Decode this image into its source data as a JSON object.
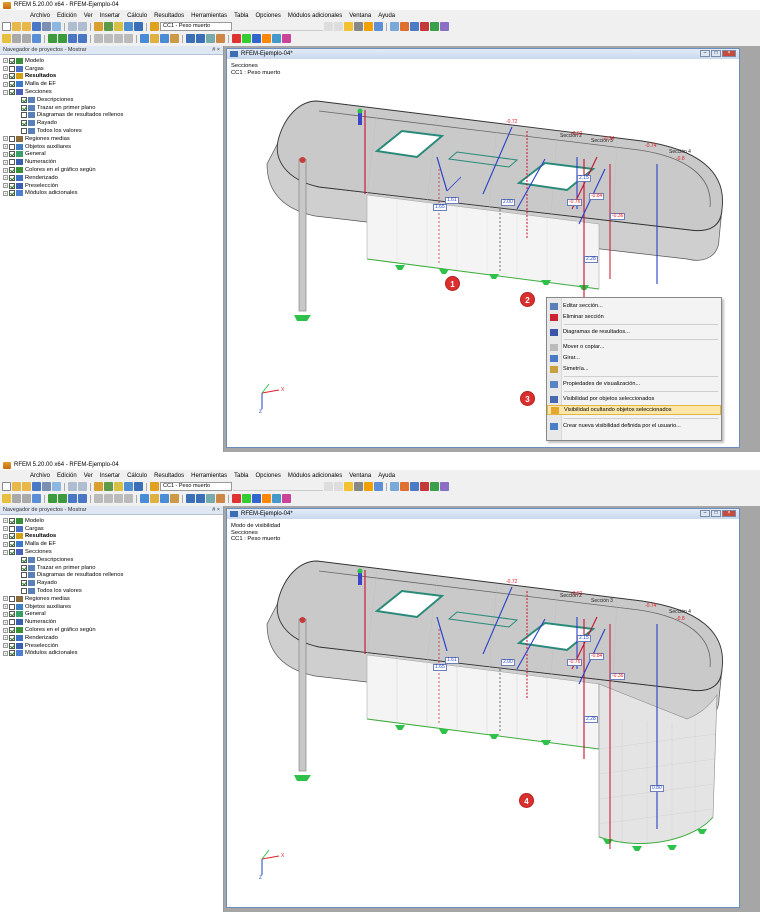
{
  "top": {
    "app_title": "RFEM 5.20.00 x64 - RFEM-Ejemplo-04",
    "menu": [
      "Archivo",
      "Edición",
      "Ver",
      "Insertar",
      "Cálculo",
      "Resultados",
      "Herramientas",
      "Tabla",
      "Opciones",
      "Módulos adicionales",
      "Ventana",
      "Ayuda"
    ],
    "load_case": "CC1 - Peso muerto",
    "navigator_title": "Navegador de proyectos - Mostrar",
    "navigator_pin": "# ×",
    "tree": [
      {
        "label": "Modelo",
        "level": 0,
        "exp": "+",
        "check": true
      },
      {
        "label": "Cargas",
        "level": 0,
        "exp": "+",
        "check": false
      },
      {
        "label": "Resultados",
        "level": 0,
        "exp": "+",
        "check": true
      },
      {
        "label": "Malla de EF",
        "level": 0,
        "exp": "+",
        "check": true
      },
      {
        "label": "Secciones",
        "level": 0,
        "exp": "−",
        "check": true
      },
      {
        "label": "Descripciones",
        "level": 1,
        "exp": "",
        "check": true
      },
      {
        "label": "Trazar en primer plano",
        "level": 1,
        "exp": "",
        "check": true
      },
      {
        "label": "Diagramas de resultados rellenos",
        "level": 1,
        "exp": "",
        "check": false
      },
      {
        "label": "Rayado",
        "level": 1,
        "exp": "",
        "check": true
      },
      {
        "label": "Todos los valores",
        "level": 1,
        "exp": "",
        "check": false
      },
      {
        "label": "Regiones medias",
        "level": 0,
        "exp": "+",
        "check": false
      },
      {
        "label": "Objetos auxiliares",
        "level": 0,
        "exp": "+",
        "check": false
      },
      {
        "label": "General",
        "level": 0,
        "exp": "+",
        "check": true
      },
      {
        "label": "Numeración",
        "level": 0,
        "exp": "+",
        "check": false
      },
      {
        "label": "Colores en el gráfico según",
        "level": 0,
        "exp": "+",
        "check": true
      },
      {
        "label": "Renderizado",
        "level": 0,
        "exp": "+",
        "check": true
      },
      {
        "label": "Preselección",
        "level": 0,
        "exp": "+",
        "check": true
      },
      {
        "label": "Módulos adicionales",
        "level": 0,
        "exp": "+",
        "check": true
      }
    ],
    "window_title": "RFEM-Ejemplo-04*",
    "info_lines": [
      "Secciones",
      "CC1 : Peso muerto"
    ],
    "section_labels": [
      "Sección 1",
      "Sección 2",
      "Sección 3",
      "Sección 4"
    ],
    "values_red": [
      "-0.72",
      "-0.92",
      "-0.34",
      "-0.74",
      "-0.8",
      "-0.76",
      "-0.84",
      "-0.36"
    ],
    "values_blue": [
      "1.65",
      "1.61",
      "2.00",
      "2.28",
      "2.15"
    ],
    "badges": [
      "1",
      "2",
      "3"
    ],
    "context_menu": [
      "Editar sección...",
      "Eliminar sección",
      "Diagramas de resultados...",
      "Mover o copiar...",
      "Girar...",
      "Simetría...",
      "Propiedades de visualización...",
      "Visibilidad por objetos seleccionados",
      "Visibilidad ocultando objetos seleccionados",
      "Crear nueva visibilidad definida por el usuario..."
    ],
    "axis_x": "X",
    "axis_z": "Z"
  },
  "bottom": {
    "app_title": "RFEM 5.20.00 x64 - RFEM-Ejemplo-04",
    "window_title": "RFEM-Ejemplo-04*",
    "info_lines": [
      "Modo de visibilidad",
      "Secciones",
      "CC1 : Peso muerto"
    ],
    "section_labels": [
      "Sección 2",
      "Sección 3",
      "Sección 4"
    ],
    "values_red": [
      "-0.72",
      "-0.92",
      "-0.74",
      "-0.8",
      "-0.76",
      "-0.84",
      "-0.36"
    ],
    "values_blue": [
      "1.65",
      "1.61",
      "2.00",
      "2.28",
      "2.15",
      "0.80"
    ],
    "badge": "4"
  },
  "colors": {
    "accent": "#d9302f",
    "section_blue": "#1f3fbf",
    "section_red": "#e0202a",
    "support_green": "#2ec24a",
    "wall_grey": "#d6d6d6",
    "slab_grey": "#c9c9c9"
  }
}
